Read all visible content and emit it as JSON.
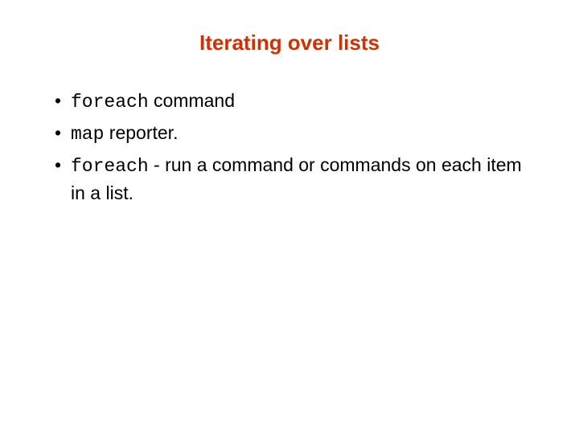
{
  "title": "Iterating over lists",
  "bullets": [
    {
      "code": "foreach",
      "rest": " command"
    },
    {
      "code": "map",
      "rest": " reporter."
    },
    {
      "code": "foreach",
      "rest": " - run a command or commands on each item in a list."
    }
  ]
}
